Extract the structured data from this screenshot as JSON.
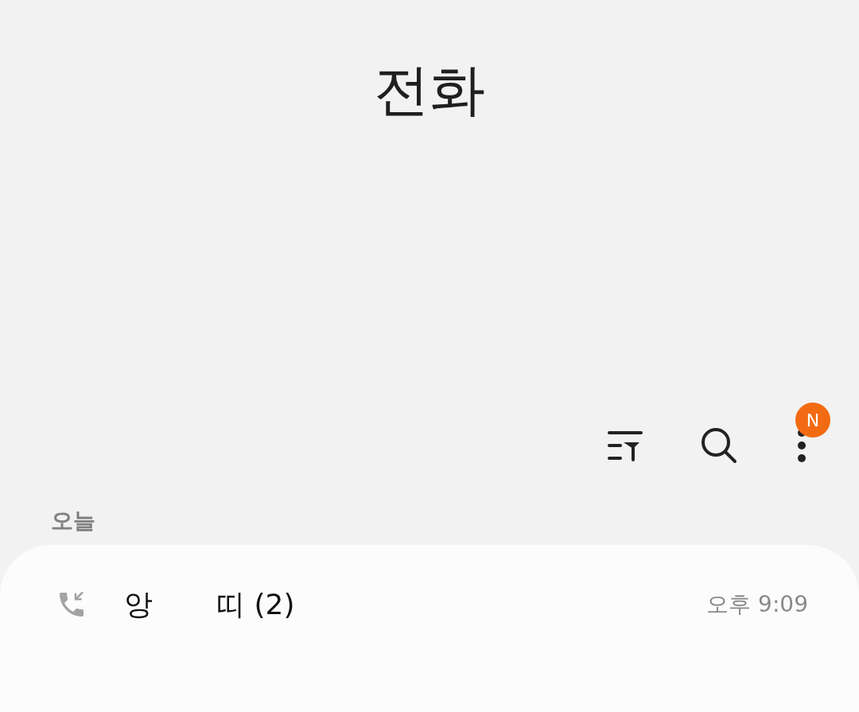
{
  "header": {
    "title": "전화"
  },
  "toolbar": {
    "badge": "N"
  },
  "section": {
    "label": "오늘"
  },
  "calls": [
    {
      "kind": "incoming",
      "name_start": "앙",
      "name_end": "띠 (2)",
      "time": "오후 9:09"
    }
  ]
}
